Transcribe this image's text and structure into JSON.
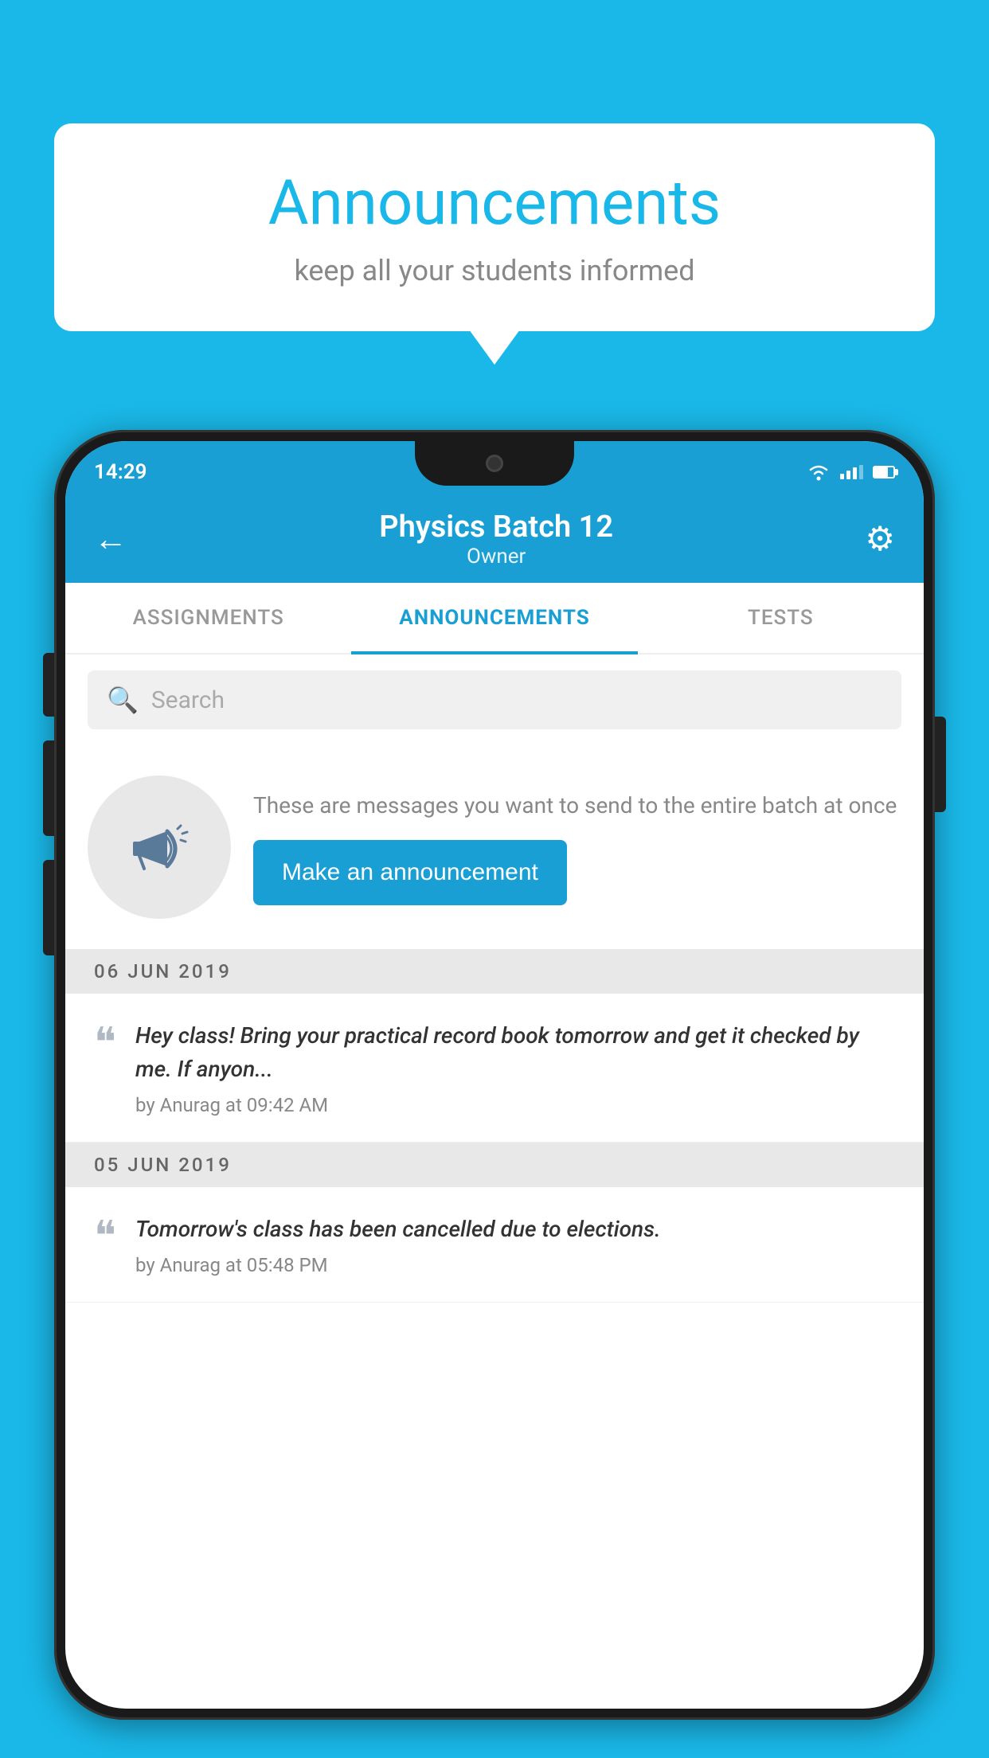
{
  "bubble": {
    "title": "Announcements",
    "subtitle": "keep all your students informed"
  },
  "statusBar": {
    "time": "14:29"
  },
  "header": {
    "title": "Physics Batch 12",
    "subtitle": "Owner"
  },
  "tabs": [
    {
      "label": "ASSIGNMENTS",
      "active": false
    },
    {
      "label": "ANNOUNCEMENTS",
      "active": true
    },
    {
      "label": "TESTS",
      "active": false
    }
  ],
  "search": {
    "placeholder": "Search"
  },
  "promo": {
    "description": "These are messages you want to send to the entire batch at once",
    "buttonLabel": "Make an announcement"
  },
  "announcements": [
    {
      "date": "06  JUN  2019",
      "text": "Hey class! Bring your practical record book tomorrow and get it checked by me. If anyon...",
      "meta": "by Anurag at 09:42 AM"
    },
    {
      "date": "05  JUN  2019",
      "text": "Tomorrow's class has been cancelled due to elections.",
      "meta": "by Anurag at 05:48 PM"
    }
  ],
  "colors": {
    "accent": "#1a9fd4",
    "background": "#1ab8e8"
  }
}
